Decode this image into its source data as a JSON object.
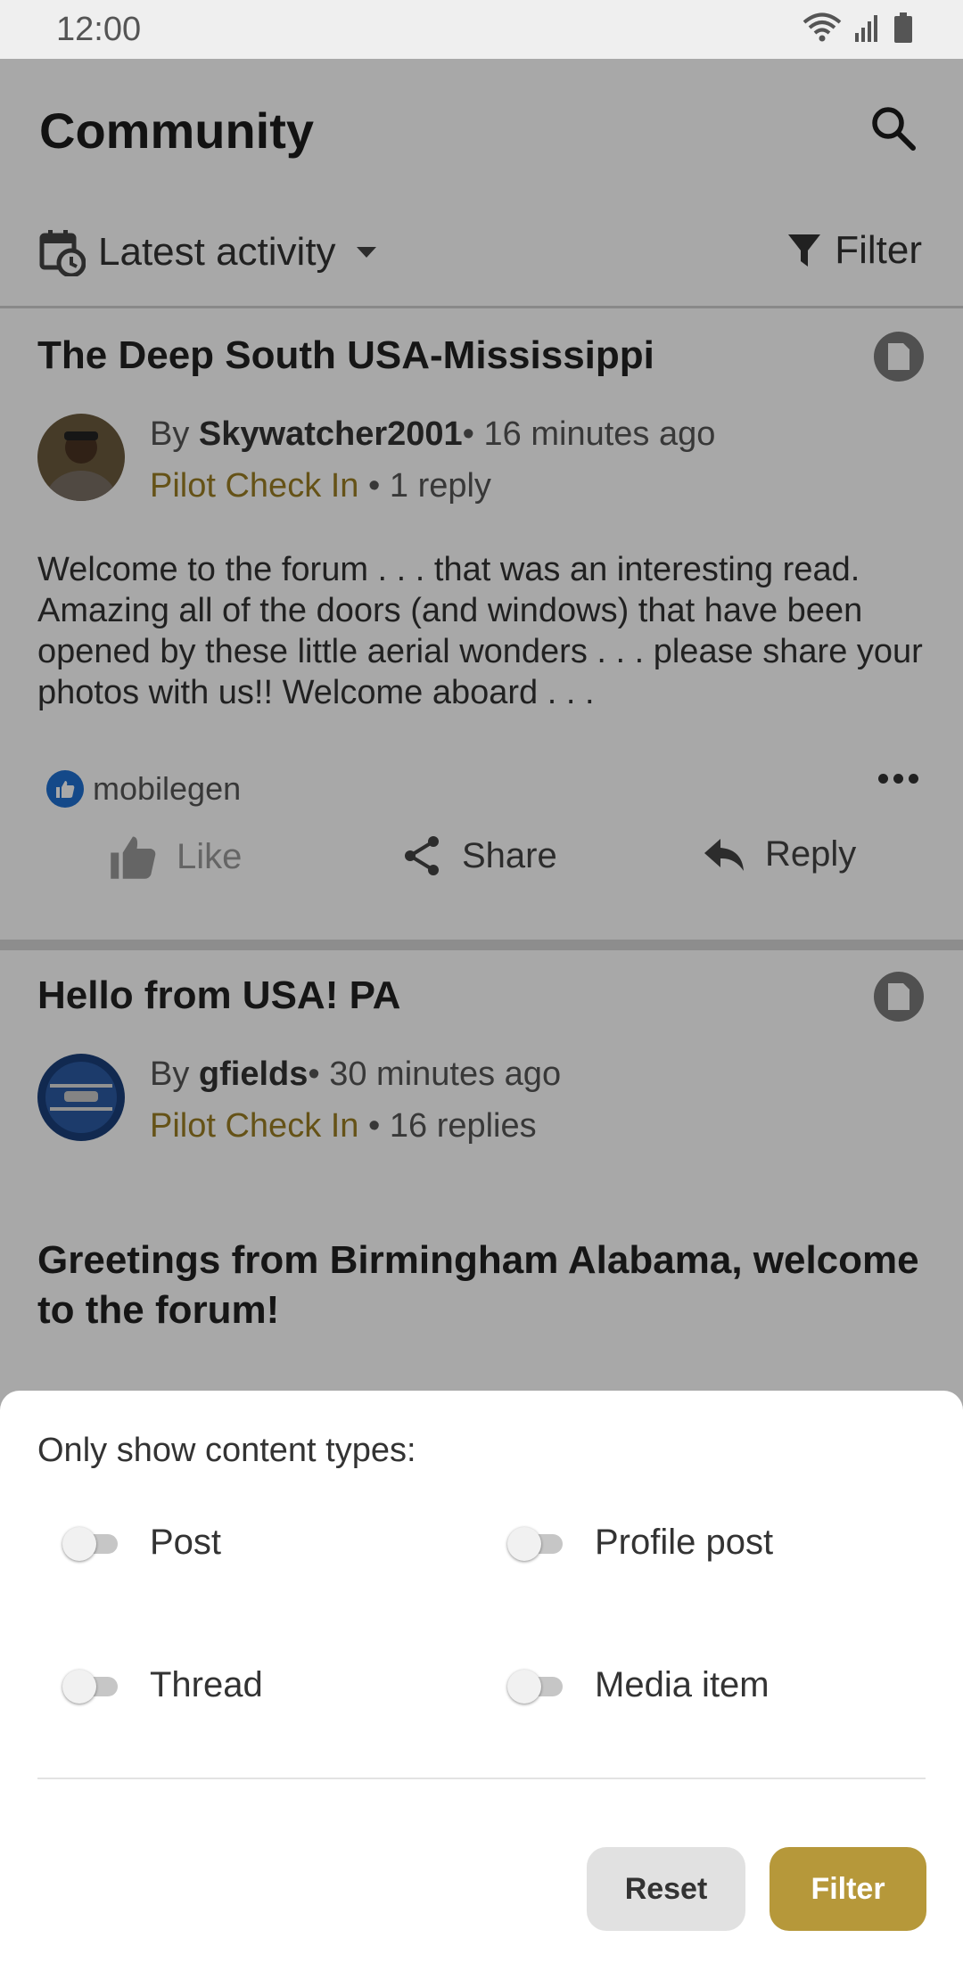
{
  "status_bar": {
    "time": "12:00"
  },
  "app_bar": {
    "title": "Community"
  },
  "filter_bar": {
    "sort_label": "Latest activity",
    "filter_label": "Filter"
  },
  "posts": [
    {
      "title": "The Deep South USA-Mississippi",
      "by_prefix": "By ",
      "author": "Skywatcher2001",
      "time": "• 16 minutes ago",
      "forum": "Pilot Check In",
      "replies": " • 1 reply",
      "body": "Welcome to the forum . . . that was an interesting read. Amazing all of the doors (and windows) that have been opened by these little aerial wonders . . . please share your photos with us!! Welcome aboard . . .",
      "liked_by": "mobilegen",
      "actions": {
        "like": "Like",
        "share": "Share",
        "reply": "Reply"
      }
    },
    {
      "title": "Hello from USA!  PA",
      "by_prefix": "By ",
      "author": "gfields",
      "time": "• 30 minutes ago",
      "forum": "Pilot Check In",
      "replies": " • 16 replies",
      "body": "Greetings from Birmingham Alabama, welcome to the forum!"
    }
  ],
  "sheet": {
    "heading": "Only show content types:",
    "options": [
      {
        "label": "Post",
        "enabled": false
      },
      {
        "label": "Profile post",
        "enabled": false
      },
      {
        "label": "Thread",
        "enabled": false
      },
      {
        "label": "Media item",
        "enabled": false
      }
    ],
    "reset_label": "Reset",
    "filter_label": "Filter"
  },
  "colors": {
    "accent": "#b6983a",
    "forum_link": "#9a7d23",
    "like_badge": "#1f6fd0"
  }
}
